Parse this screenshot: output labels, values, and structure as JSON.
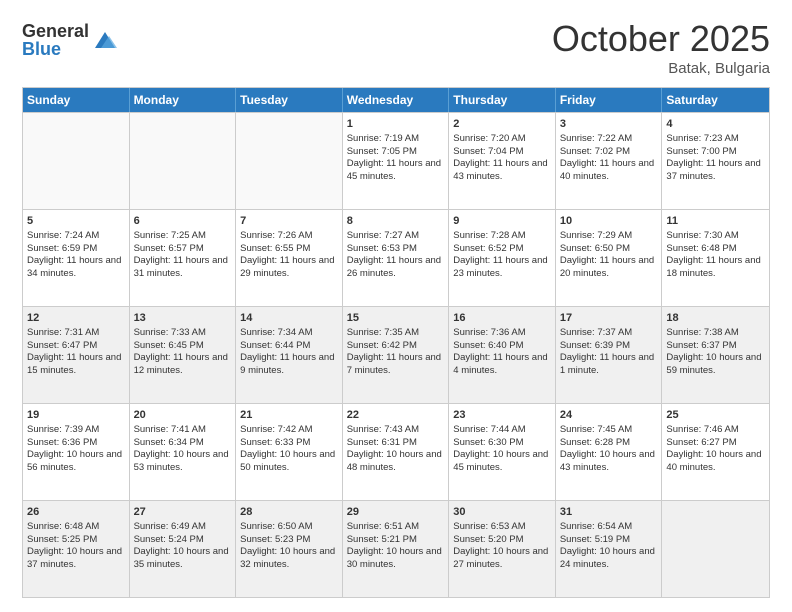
{
  "logo": {
    "general": "General",
    "blue": "Blue"
  },
  "title": "October 2025",
  "location": "Batak, Bulgaria",
  "days_of_week": [
    "Sunday",
    "Monday",
    "Tuesday",
    "Wednesday",
    "Thursday",
    "Friday",
    "Saturday"
  ],
  "weeks": [
    [
      {
        "num": "",
        "sunrise": "",
        "sunset": "",
        "daylight": "",
        "empty": true
      },
      {
        "num": "",
        "sunrise": "",
        "sunset": "",
        "daylight": "",
        "empty": true
      },
      {
        "num": "",
        "sunrise": "",
        "sunset": "",
        "daylight": "",
        "empty": true
      },
      {
        "num": "1",
        "sunrise": "Sunrise: 7:19 AM",
        "sunset": "Sunset: 7:05 PM",
        "daylight": "Daylight: 11 hours and 45 minutes."
      },
      {
        "num": "2",
        "sunrise": "Sunrise: 7:20 AM",
        "sunset": "Sunset: 7:04 PM",
        "daylight": "Daylight: 11 hours and 43 minutes."
      },
      {
        "num": "3",
        "sunrise": "Sunrise: 7:22 AM",
        "sunset": "Sunset: 7:02 PM",
        "daylight": "Daylight: 11 hours and 40 minutes."
      },
      {
        "num": "4",
        "sunrise": "Sunrise: 7:23 AM",
        "sunset": "Sunset: 7:00 PM",
        "daylight": "Daylight: 11 hours and 37 minutes."
      }
    ],
    [
      {
        "num": "5",
        "sunrise": "Sunrise: 7:24 AM",
        "sunset": "Sunset: 6:59 PM",
        "daylight": "Daylight: 11 hours and 34 minutes."
      },
      {
        "num": "6",
        "sunrise": "Sunrise: 7:25 AM",
        "sunset": "Sunset: 6:57 PM",
        "daylight": "Daylight: 11 hours and 31 minutes."
      },
      {
        "num": "7",
        "sunrise": "Sunrise: 7:26 AM",
        "sunset": "Sunset: 6:55 PM",
        "daylight": "Daylight: 11 hours and 29 minutes."
      },
      {
        "num": "8",
        "sunrise": "Sunrise: 7:27 AM",
        "sunset": "Sunset: 6:53 PM",
        "daylight": "Daylight: 11 hours and 26 minutes."
      },
      {
        "num": "9",
        "sunrise": "Sunrise: 7:28 AM",
        "sunset": "Sunset: 6:52 PM",
        "daylight": "Daylight: 11 hours and 23 minutes."
      },
      {
        "num": "10",
        "sunrise": "Sunrise: 7:29 AM",
        "sunset": "Sunset: 6:50 PM",
        "daylight": "Daylight: 11 hours and 20 minutes."
      },
      {
        "num": "11",
        "sunrise": "Sunrise: 7:30 AM",
        "sunset": "Sunset: 6:48 PM",
        "daylight": "Daylight: 11 hours and 18 minutes."
      }
    ],
    [
      {
        "num": "12",
        "sunrise": "Sunrise: 7:31 AM",
        "sunset": "Sunset: 6:47 PM",
        "daylight": "Daylight: 11 hours and 15 minutes.",
        "shaded": true
      },
      {
        "num": "13",
        "sunrise": "Sunrise: 7:33 AM",
        "sunset": "Sunset: 6:45 PM",
        "daylight": "Daylight: 11 hours and 12 minutes.",
        "shaded": true
      },
      {
        "num": "14",
        "sunrise": "Sunrise: 7:34 AM",
        "sunset": "Sunset: 6:44 PM",
        "daylight": "Daylight: 11 hours and 9 minutes.",
        "shaded": true
      },
      {
        "num": "15",
        "sunrise": "Sunrise: 7:35 AM",
        "sunset": "Sunset: 6:42 PM",
        "daylight": "Daylight: 11 hours and 7 minutes.",
        "shaded": true
      },
      {
        "num": "16",
        "sunrise": "Sunrise: 7:36 AM",
        "sunset": "Sunset: 6:40 PM",
        "daylight": "Daylight: 11 hours and 4 minutes.",
        "shaded": true
      },
      {
        "num": "17",
        "sunrise": "Sunrise: 7:37 AM",
        "sunset": "Sunset: 6:39 PM",
        "daylight": "Daylight: 11 hours and 1 minute.",
        "shaded": true
      },
      {
        "num": "18",
        "sunrise": "Sunrise: 7:38 AM",
        "sunset": "Sunset: 6:37 PM",
        "daylight": "Daylight: 10 hours and 59 minutes.",
        "shaded": true
      }
    ],
    [
      {
        "num": "19",
        "sunrise": "Sunrise: 7:39 AM",
        "sunset": "Sunset: 6:36 PM",
        "daylight": "Daylight: 10 hours and 56 minutes."
      },
      {
        "num": "20",
        "sunrise": "Sunrise: 7:41 AM",
        "sunset": "Sunset: 6:34 PM",
        "daylight": "Daylight: 10 hours and 53 minutes."
      },
      {
        "num": "21",
        "sunrise": "Sunrise: 7:42 AM",
        "sunset": "Sunset: 6:33 PM",
        "daylight": "Daylight: 10 hours and 50 minutes."
      },
      {
        "num": "22",
        "sunrise": "Sunrise: 7:43 AM",
        "sunset": "Sunset: 6:31 PM",
        "daylight": "Daylight: 10 hours and 48 minutes."
      },
      {
        "num": "23",
        "sunrise": "Sunrise: 7:44 AM",
        "sunset": "Sunset: 6:30 PM",
        "daylight": "Daylight: 10 hours and 45 minutes."
      },
      {
        "num": "24",
        "sunrise": "Sunrise: 7:45 AM",
        "sunset": "Sunset: 6:28 PM",
        "daylight": "Daylight: 10 hours and 43 minutes."
      },
      {
        "num": "25",
        "sunrise": "Sunrise: 7:46 AM",
        "sunset": "Sunset: 6:27 PM",
        "daylight": "Daylight: 10 hours and 40 minutes."
      }
    ],
    [
      {
        "num": "26",
        "sunrise": "Sunrise: 6:48 AM",
        "sunset": "Sunset: 5:25 PM",
        "daylight": "Daylight: 10 hours and 37 minutes.",
        "shaded": true
      },
      {
        "num": "27",
        "sunrise": "Sunrise: 6:49 AM",
        "sunset": "Sunset: 5:24 PM",
        "daylight": "Daylight: 10 hours and 35 minutes.",
        "shaded": true
      },
      {
        "num": "28",
        "sunrise": "Sunrise: 6:50 AM",
        "sunset": "Sunset: 5:23 PM",
        "daylight": "Daylight: 10 hours and 32 minutes.",
        "shaded": true
      },
      {
        "num": "29",
        "sunrise": "Sunrise: 6:51 AM",
        "sunset": "Sunset: 5:21 PM",
        "daylight": "Daylight: 10 hours and 30 minutes.",
        "shaded": true
      },
      {
        "num": "30",
        "sunrise": "Sunrise: 6:53 AM",
        "sunset": "Sunset: 5:20 PM",
        "daylight": "Daylight: 10 hours and 27 minutes.",
        "shaded": true
      },
      {
        "num": "31",
        "sunrise": "Sunrise: 6:54 AM",
        "sunset": "Sunset: 5:19 PM",
        "daylight": "Daylight: 10 hours and 24 minutes.",
        "shaded": true
      },
      {
        "num": "",
        "sunrise": "",
        "sunset": "",
        "daylight": "",
        "empty": true,
        "shaded": true
      }
    ]
  ]
}
